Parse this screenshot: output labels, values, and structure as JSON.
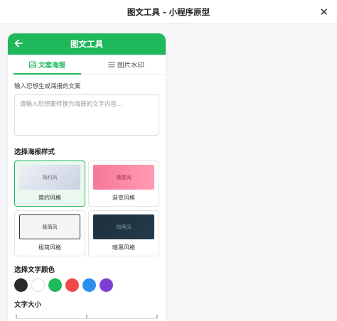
{
  "window": {
    "title": "图文工具 - 小程序原型",
    "close_glyph": "✕"
  },
  "app": {
    "title": "图文工具",
    "tabs": [
      {
        "label": "文案海报",
        "active": true
      },
      {
        "label": "图片水印",
        "active": false
      }
    ],
    "input": {
      "label": "输入您想生成海报的文案",
      "placeholder": "请输入您想要转换为海报的文字内容..."
    },
    "style_section": {
      "title": "选择海报样式",
      "styles": [
        {
          "preview": "简约风",
          "name": "简约风格",
          "selected": true
        },
        {
          "preview": "渐变风",
          "name": "渐变风格",
          "selected": false
        },
        {
          "preview": "极简风",
          "name": "极简风格",
          "selected": false
        },
        {
          "preview": "暗黑风",
          "name": "暗黑风格",
          "selected": false
        }
      ]
    },
    "color_section": {
      "title": "选择文字颜色",
      "colors": [
        "#2b2b2b",
        "#ffffff",
        "#1fb85a",
        "#ef4a4a",
        "#2b8ff0",
        "#7d3fd1"
      ]
    },
    "size_section": {
      "title": "文字大小"
    },
    "accent_color": "#1fb85a"
  }
}
